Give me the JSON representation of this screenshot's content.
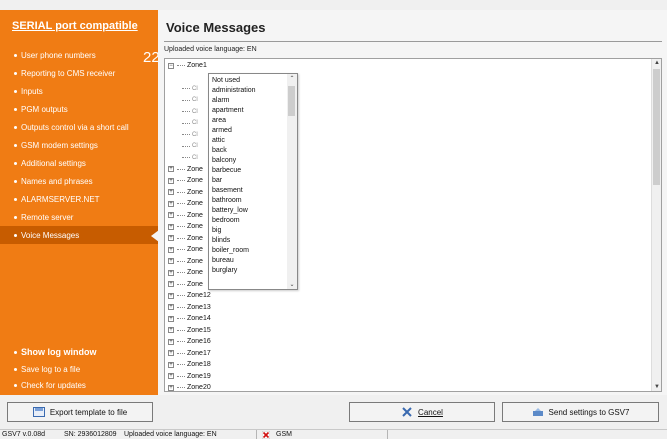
{
  "sidebar": {
    "header": "SERIAL port compatible",
    "badge": "22",
    "items": [
      {
        "label": "User phone numbers"
      },
      {
        "label": "Reporting to CMS receiver"
      },
      {
        "label": "Inputs"
      },
      {
        "label": "PGM outputs"
      },
      {
        "label": "Outputs control via a short call"
      },
      {
        "label": "GSM modem settings"
      },
      {
        "label": "Additional settings"
      },
      {
        "label": "Names and phrases"
      },
      {
        "label": "ALARMSERVER.NET"
      },
      {
        "label": "Remote server"
      },
      {
        "label": "Voice Messages",
        "active": true
      }
    ],
    "bottom": [
      {
        "label": "Show log window"
      },
      {
        "label": "Save log to a file"
      },
      {
        "label": "Check for updates"
      }
    ]
  },
  "main": {
    "title": "Voice Messages",
    "language_label": "Uploaded voice language: EN",
    "tree": {
      "expanded_zone": "Zone1",
      "child_prefix": [
        "Cl",
        "Cl",
        "Cl",
        "Cl",
        "Cl",
        "Cl",
        "Cl"
      ],
      "zones_truncated": [
        "Zone",
        "Zone",
        "Zone",
        "Zone",
        "Zone",
        "Zone",
        "Zone",
        "Zone",
        "Zone",
        "Zone",
        "Zone"
      ],
      "zones": [
        "Zone12",
        "Zone13",
        "Zone14",
        "Zone15",
        "Zone16",
        "Zone17",
        "Zone18",
        "Zone19",
        "Zone20"
      ]
    },
    "dropdown": {
      "options": [
        "Not used",
        "administration",
        "alarm",
        "apartment",
        "area",
        "armed",
        "attic",
        "back",
        "balcony",
        "barbecue",
        "bar",
        "basement",
        "bathroom",
        "battery_low",
        "bedroom",
        "big",
        "blinds",
        "boiler_room",
        "bureau",
        "burglary"
      ]
    }
  },
  "buttons": {
    "export": "Export template to file",
    "cancel": "Cancel",
    "send": "Send settings to GSV7"
  },
  "status": {
    "version": "GSV7 v.0.08d",
    "serial": "SN: 2936012809",
    "language": "Uploaded voice language: EN",
    "connection": "GSM"
  },
  "colors": {
    "sidebar_bg": "#f07c14",
    "sidebar_active": "#c75c00",
    "error_icon": "#d01010"
  }
}
